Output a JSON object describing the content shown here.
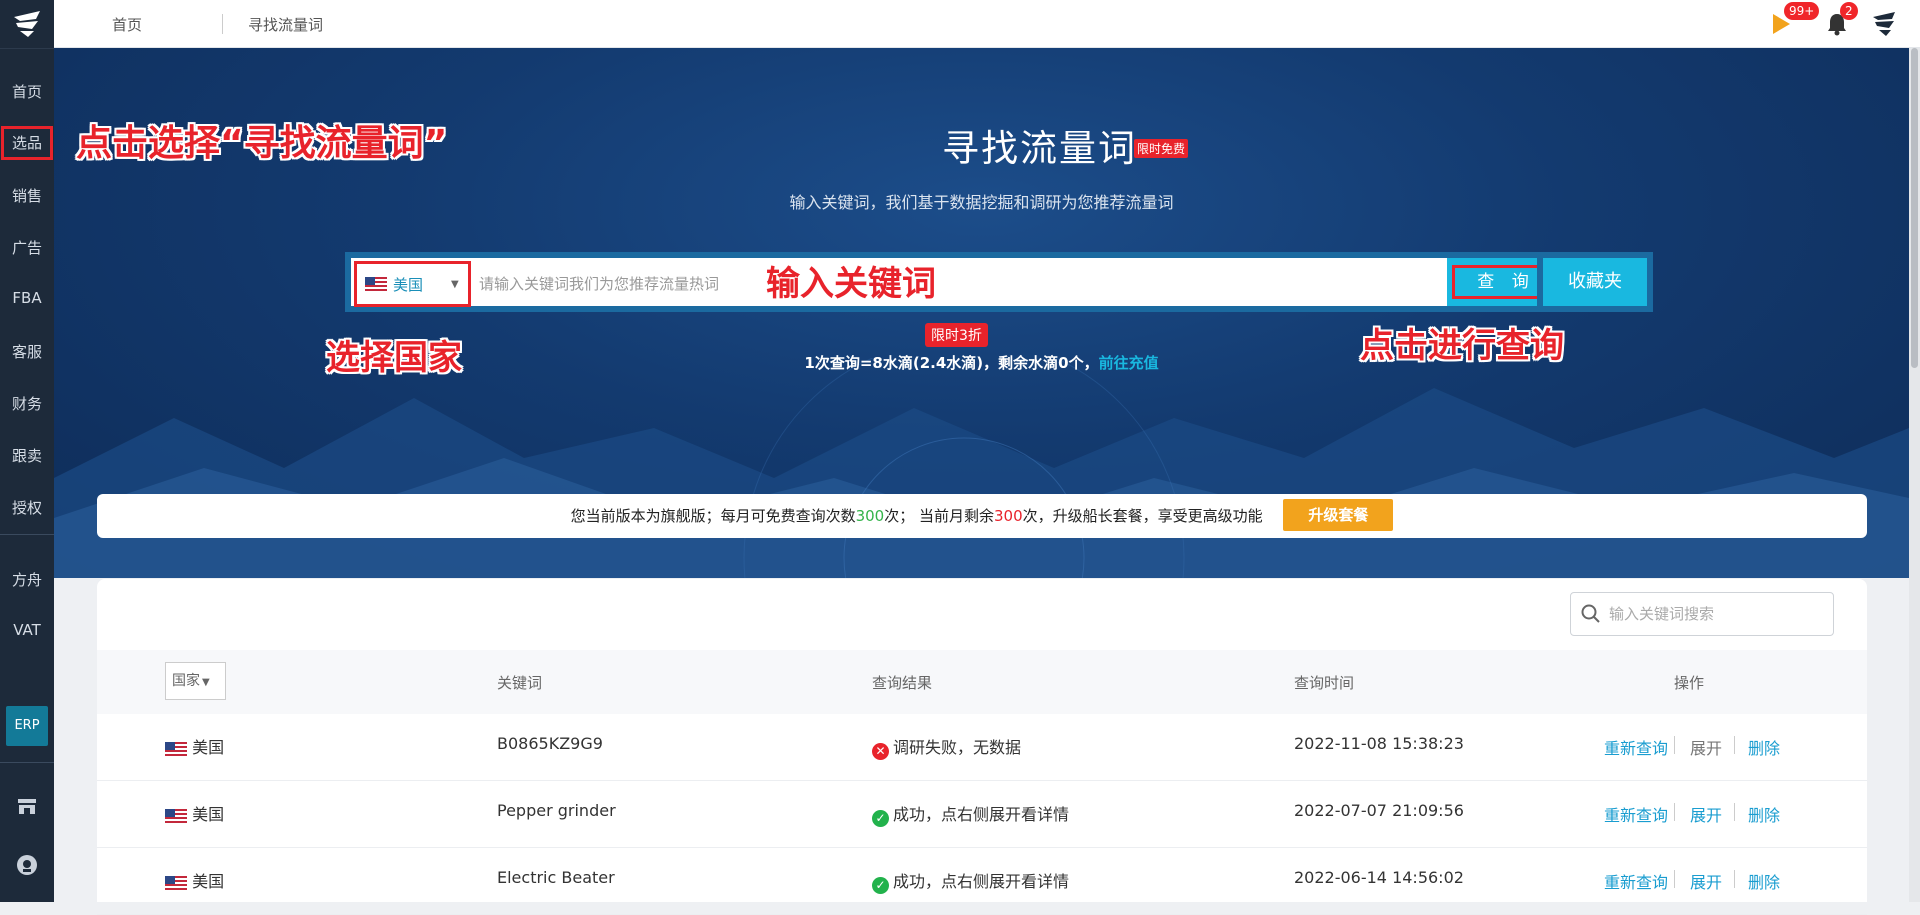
{
  "sidebar": {
    "items": [
      "首页",
      "选品",
      "销售",
      "广告",
      "FBA",
      "客服",
      "财务",
      "跟卖",
      "授权",
      "方舟",
      "VAT"
    ],
    "erp": "ERP"
  },
  "topbar": {
    "crumbs": [
      "首页",
      "寻找流量词"
    ],
    "flag_badge": "99+",
    "bell_badge": "2"
  },
  "hero": {
    "title": "寻找流量词",
    "free_tag": "限时免费",
    "subtitle": "输入关键词，我们基于数据挖掘和调研为您推荐流量词",
    "country": "美国",
    "search_placeholder": "请输入关键词我们为您推荐流量热词",
    "query_label": "查 询",
    "favorites_label": "收藏夹",
    "discount_tag": "限时3折",
    "cost_text": "1次查询=8水滴(2.4水滴)，剩余水滴0个，",
    "recharge_link": "前往充值"
  },
  "annotations": {
    "select_menu": "点击选择“寻找流量词”",
    "input_keyword": "输入关键词",
    "select_country": "选择国家",
    "click_query": "点击进行查询"
  },
  "notice": {
    "part1": "您当前版本为旗舰版；每月可免费查询次数",
    "monthly_free": "300",
    "part2": "次；  当前月剩余",
    "remaining": "300",
    "part3": "次，升级船长套餐，享受更高级功能",
    "upgrade_label": "升级套餐"
  },
  "table": {
    "search_placeholder": "输入关键词搜索",
    "country_filter": "国家",
    "headers": [
      "关键词",
      "查询结果",
      "查询时间",
      "操作"
    ],
    "rows": [
      {
        "country": "美国",
        "keyword": "B0865KZ9G9",
        "result": "调研失败，无数据",
        "status": "fail",
        "time": "2022-11-08 15:38:23"
      },
      {
        "country": "美国",
        "keyword": "Pepper grinder",
        "result": "成功，点右侧展开看详情",
        "status": "ok",
        "time": "2022-07-07 21:09:56"
      },
      {
        "country": "美国",
        "keyword": "Electric Beater",
        "result": "成功，点右侧展开看详情",
        "status": "ok",
        "time": "2022-06-14 14:56:02"
      }
    ],
    "ops": {
      "requery": "重新查询",
      "expand": "展开",
      "delete": "删除"
    }
  },
  "colors": {
    "accent": "#19b8e0",
    "annotation": "#e8232b",
    "sidebar": "#1d2a3a",
    "upgrade": "#f2a31d"
  }
}
